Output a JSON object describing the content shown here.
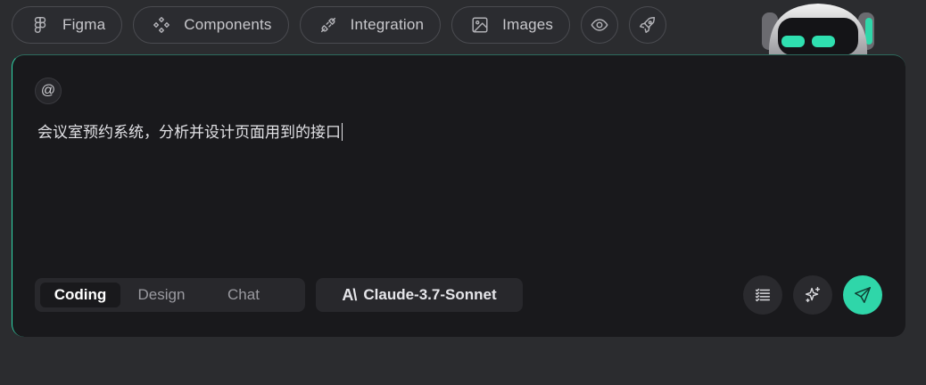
{
  "toolbar": {
    "figma_label": "Figma",
    "components_label": "Components",
    "integration_label": "Integration",
    "images_label": "Images"
  },
  "input": {
    "at_symbol": "@",
    "prompt_text": "会议室预约系统，分析并设计页面用到的接口"
  },
  "modes": {
    "coding_label": "Coding",
    "design_label": "Design",
    "chat_label": "Chat",
    "active": "Coding"
  },
  "model": {
    "logo_text": "A\\",
    "name": "Claude-3.7-Sonnet"
  },
  "colors": {
    "accent": "#2fd6a9",
    "background": "#2b2c2f",
    "card": "#19191c"
  },
  "icons": [
    "figma-icon",
    "components-icon",
    "integration-icon",
    "images-icon",
    "eye-icon",
    "rocket-icon",
    "list-icon",
    "sparkle-icon",
    "send-icon"
  ]
}
